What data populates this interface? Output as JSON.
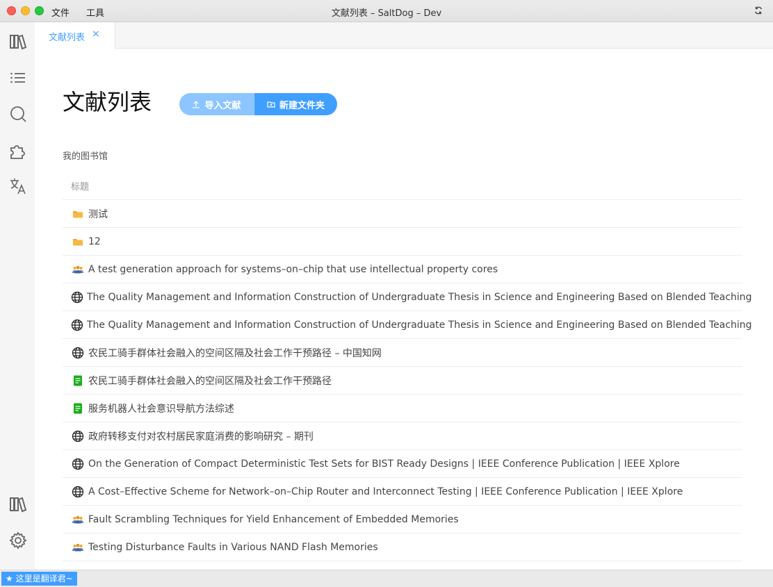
{
  "window": {
    "title": "文献列表 – SaltDog – Dev",
    "menu": [
      "文件",
      "工具"
    ]
  },
  "rail": {
    "items": [
      "library-icon",
      "list-icon",
      "search-icon",
      "plugin-icon",
      "translate-icon"
    ],
    "bottom": [
      "library-icon",
      "gear-icon"
    ]
  },
  "tabs": [
    {
      "label": "文献列表",
      "close": "×"
    }
  ],
  "page": {
    "title": "文献列表",
    "import_label": "导入文献",
    "new_folder_label": "新建文件夹",
    "section": "我的图书馆"
  },
  "table": {
    "header": "标题",
    "rows": [
      {
        "icon": "folder-icon",
        "title": "测试"
      },
      {
        "icon": "folder-icon",
        "title": "12"
      },
      {
        "icon": "people-icon",
        "title": "A test generation approach for systems–on–chip that use intellectual property cores"
      },
      {
        "icon": "globe-icon",
        "title": "The Quality Management and Information Construction of Undergraduate Thesis in Science and Engineering Based on Blended Teaching"
      },
      {
        "icon": "globe-icon",
        "title": "The Quality Management and Information Construction of Undergraduate Thesis in Science and Engineering Based on Blended Teaching"
      },
      {
        "icon": "globe-icon",
        "title": "农民工骑手群体社会融入的空间区隔及社会工作干预路径 – 中国知网"
      },
      {
        "icon": "document-icon",
        "title": "农民工骑手群体社会融入的空间区隔及社会工作干预路径"
      },
      {
        "icon": "document-icon",
        "title": "服务机器人社会意识导航方法综述"
      },
      {
        "icon": "globe-icon",
        "title": "政府转移支付对农村居民家庭消费的影响研究 – 期刊"
      },
      {
        "icon": "globe-icon",
        "title": "On the Generation of Compact Deterministic Test Sets for BIST Ready Designs | IEEE Conference Publication | IEEE Xplore"
      },
      {
        "icon": "globe-icon",
        "title": "A Cost–Effective Scheme for Network–on–Chip Router and Interconnect Testing | IEEE Conference Publication | IEEE Xplore"
      },
      {
        "icon": "people-icon",
        "title": "Fault Scrambling Techniques for Yield Enhancement of Embedded Memories"
      },
      {
        "icon": "people-icon",
        "title": "Testing Disturbance Faults in Various NAND Flash Memories"
      }
    ]
  },
  "status": {
    "chip": "★ 这里是翻译君~"
  },
  "colors": {
    "accent": "#409eff",
    "accent_light": "#8cc5ff",
    "folder": "#f5a623",
    "doc": "#1aad19"
  }
}
